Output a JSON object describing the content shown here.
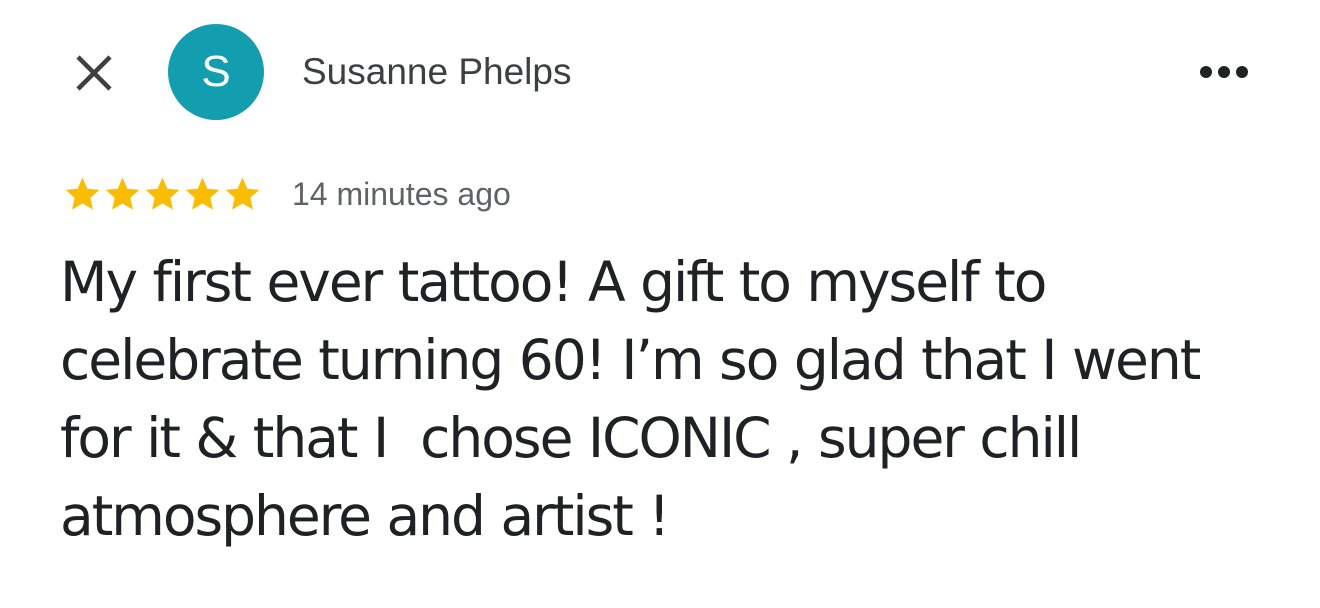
{
  "header": {
    "close_icon": "close-icon",
    "avatar": {
      "initial": "S",
      "color": "#129eaf"
    },
    "author_name": "Susanne Phelps",
    "more_icon": "more-horizontal-icon"
  },
  "review": {
    "rating": 5,
    "max_rating": 5,
    "star_color": "#fbbc04",
    "timestamp": "14 minutes ago",
    "text_lines": [
      "My first ever tattoo! A gift to myself to",
      "celebrate turning 60! I’m so glad that I went",
      "for it & that I  chose ICONIC , super chill",
      "atmosphere and artist !"
    ]
  }
}
